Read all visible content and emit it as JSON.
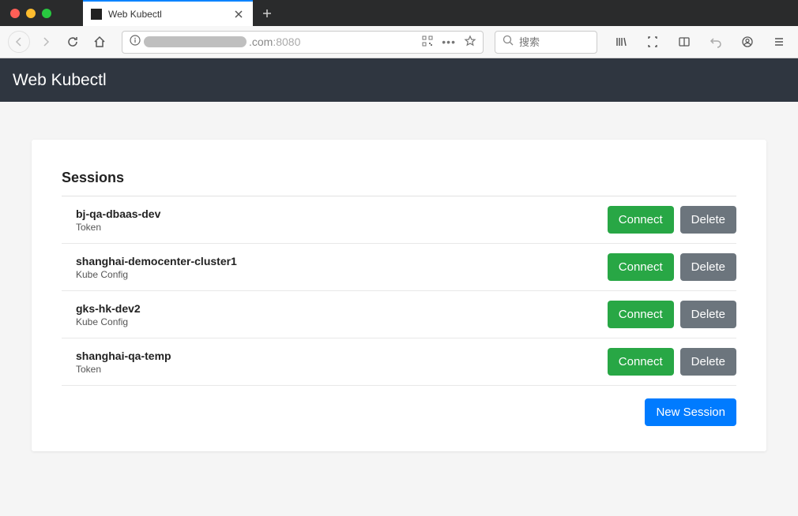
{
  "browser": {
    "tab_title": "Web Kubectl",
    "url_visible_suffix": ".com",
    "url_port": ":8080",
    "search_placeholder": "搜索"
  },
  "app": {
    "title": "Web Kubectl"
  },
  "sessions": {
    "heading": "Sessions",
    "connect_label": "Connect",
    "delete_label": "Delete",
    "new_session_label": "New Session",
    "items": [
      {
        "name": "bj-qa-dbaas-dev",
        "type": "Token"
      },
      {
        "name": "shanghai-democenter-cluster1",
        "type": "Kube Config"
      },
      {
        "name": "gks-hk-dev2",
        "type": "Kube Config"
      },
      {
        "name": "shanghai-qa-temp",
        "type": "Token"
      }
    ]
  }
}
